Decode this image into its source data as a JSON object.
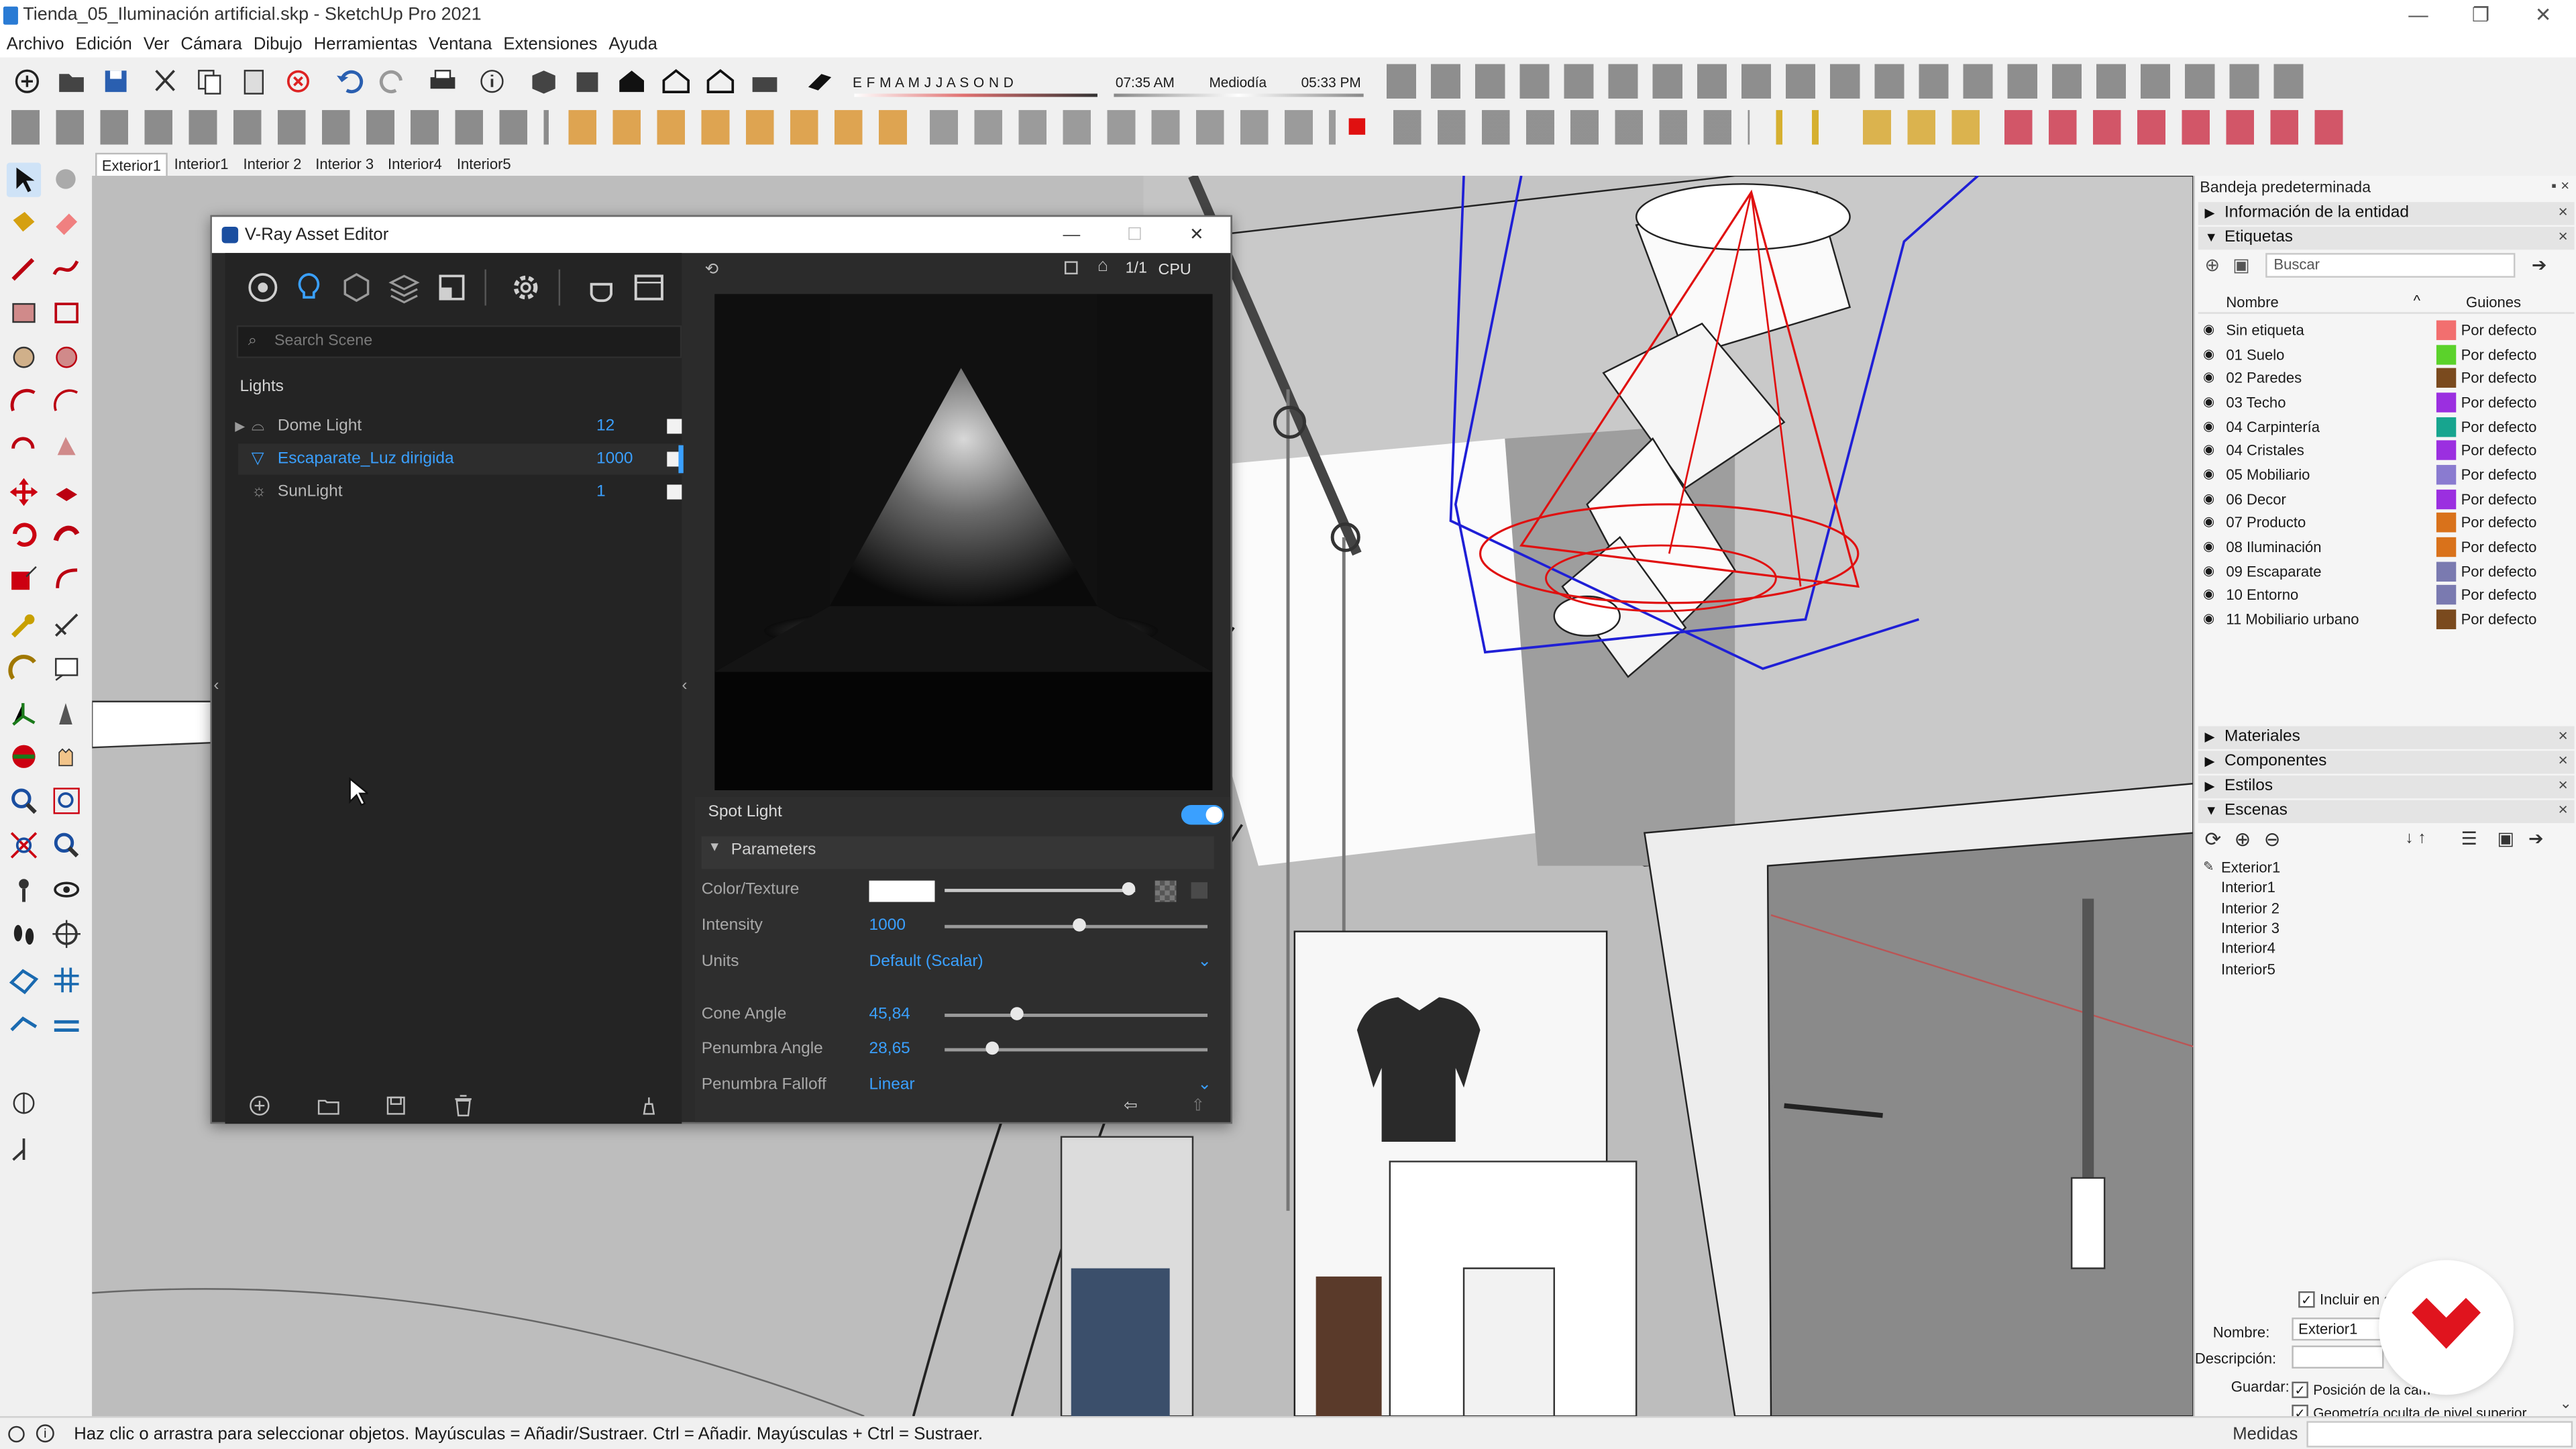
{
  "window": {
    "title": "Tienda_05_Iluminación artificial.skp - SketchUp Pro 2021",
    "controls": [
      "—",
      "❐",
      "✕"
    ]
  },
  "menu": [
    "Archivo",
    "Edición",
    "Ver",
    "Cámara",
    "Dibujo",
    "Herramientas",
    "Ventana",
    "Extensiones",
    "Ayuda"
  ],
  "shadow": {
    "months": "E F M A M J J A S O N D",
    "time_start": "07:35 AM",
    "time_mid": "Mediodía",
    "time_end": "05:33 PM"
  },
  "scene_tabs": [
    "Exterior1",
    "Interior1",
    "Interior 2",
    "Interior 3",
    "Interior4",
    "Interior5"
  ],
  "vray": {
    "title": "V-Ray Asset Editor",
    "search_placeholder": "Search Scene",
    "section": "Lights",
    "lights": [
      {
        "name": "Dome Light",
        "value": "12"
      },
      {
        "name": "Escaparate_Luz dirigida",
        "value": "1000"
      },
      {
        "name": "SunLight",
        "value": "1"
      }
    ],
    "preview_ratio": "1/1",
    "engine": "CPU",
    "light_type": "Spot Light",
    "params_header": "Parameters",
    "params": {
      "color_label": "Color/Texture",
      "intensity_label": "Intensity",
      "intensity_value": "1000",
      "units_label": "Units",
      "units_value": "Default (Scalar)",
      "cone_label": "Cone Angle",
      "cone_value": "45,84",
      "penumbra_label": "Penumbra Angle",
      "penumbra_value": "28,65",
      "falloff_label": "Penumbra Falloff",
      "falloff_value": "Linear"
    }
  },
  "tray": {
    "title": "Bandeja predeterminada",
    "entity_info": "Información de la entidad",
    "tags_title": "Etiquetas",
    "search_placeholder": "Buscar",
    "col_name": "Nombre",
    "col_dashes": "Guiones",
    "tags": [
      {
        "name": "Sin etiqueta",
        "color": "#f26f6f",
        "line": "Por defecto"
      },
      {
        "name": "01 Suelo",
        "color": "#5bd22b",
        "line": "Por defecto"
      },
      {
        "name": "02 Paredes",
        "color": "#7a4a1e",
        "line": "Por defecto"
      },
      {
        "name": "03 Techo",
        "color": "#9b2fe0",
        "line": "Por defecto"
      },
      {
        "name": "04 Carpintería",
        "color": "#17a58f",
        "line": "Por defecto"
      },
      {
        "name": "04 Cristales",
        "color": "#9b2fe0",
        "line": "Por defecto"
      },
      {
        "name": "05 Mobiliario",
        "color": "#8a7bd0",
        "line": "Por defecto"
      },
      {
        "name": "06 Decor",
        "color": "#9b2fe0",
        "line": "Por defecto"
      },
      {
        "name": "07 Producto",
        "color": "#d9721b",
        "line": "Por defecto"
      },
      {
        "name": "08 Iluminación",
        "color": "#d9721b",
        "line": "Por defecto"
      },
      {
        "name": "09 Escaparate",
        "color": "#7a7ab0",
        "line": "Por defecto"
      },
      {
        "name": "10 Entorno",
        "color": "#7a7ab0",
        "line": "Por defecto"
      },
      {
        "name": "11 Mobiliario urbano",
        "color": "#7a4a1e",
        "line": "Por defecto"
      }
    ],
    "materials": "Materiales",
    "components": "Componentes",
    "styles": "Estilos",
    "scenes_title": "Escenas",
    "scenes": [
      "Exterior1",
      "Interior1",
      "Interior 2",
      "Interior 3",
      "Interior4",
      "Interior5"
    ],
    "include_label": "Incluir en a",
    "name_label": "Nombre:",
    "name_value": "Exterior1",
    "desc_label": "Descripción:",
    "save_label": "Guardar:",
    "save_opt1": "Posición de la cám",
    "save_opt2": "Geometría oculta de nivel superior"
  },
  "status": {
    "message": "Haz clic o arrastra para seleccionar objetos. Mayúsculas = Añadir/Sustraer. Ctrl = Añadir. Mayúsculas + Ctrl = Sustraer.",
    "measures_label": "Medidas"
  },
  "colors": {
    "vray_accent": "#3aa0ff",
    "selection_blue": "#1f1fd6",
    "light_red": "#e01010",
    "brand_red": "#e0141e"
  }
}
